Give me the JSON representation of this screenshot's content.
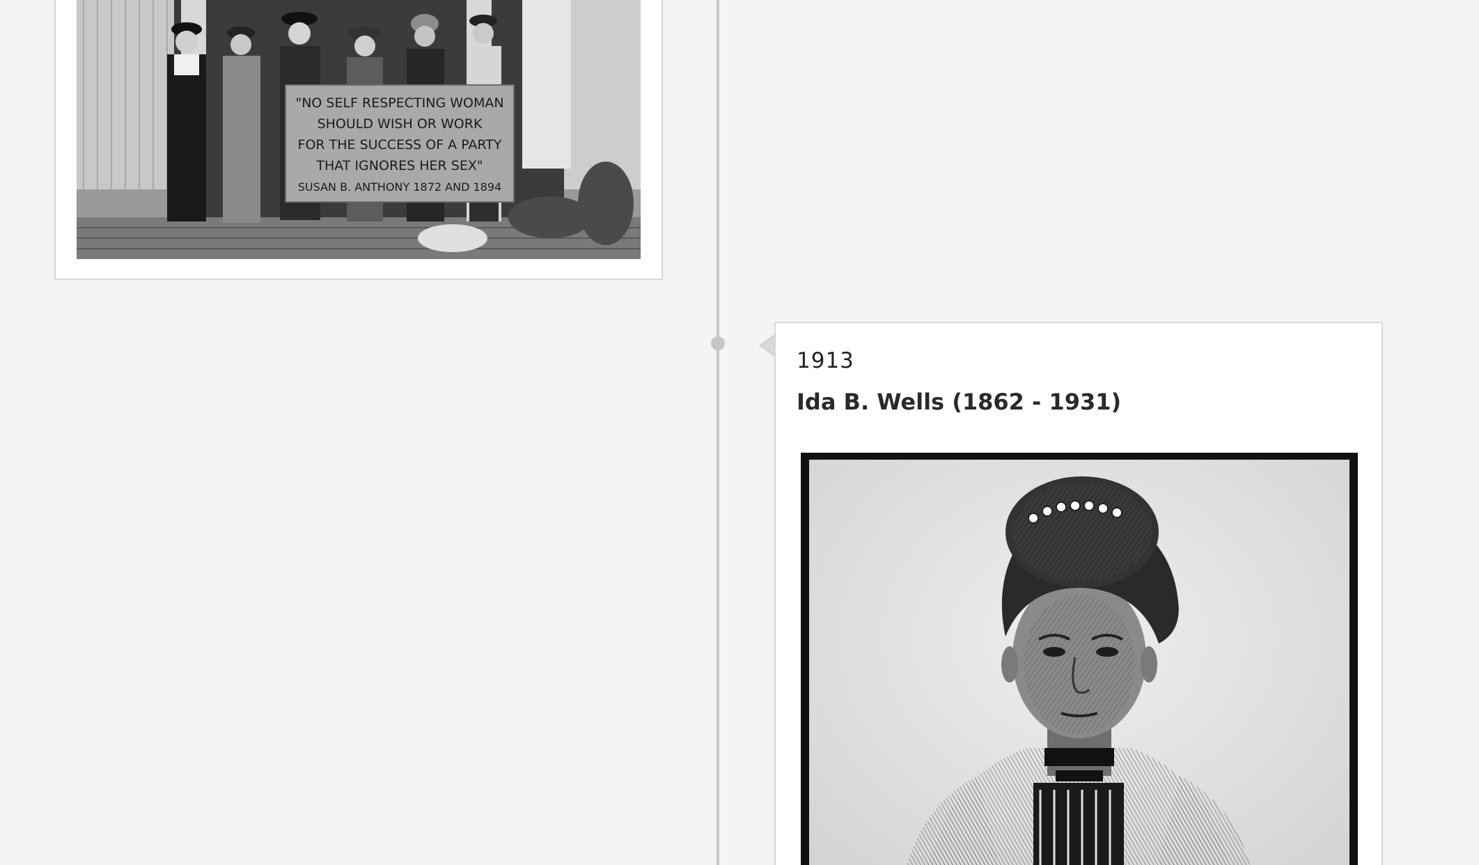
{
  "timeline": {
    "events": [
      {
        "image": {
          "alt": "Suffragists holding a banner",
          "banner_lines": [
            "\"NO SELF RESPECTING WOMAN",
            "SHOULD WISH OR WORK",
            "FOR THE SUCCESS OF A PARTY",
            "THAT IGNORES HER SEX\"",
            "SUSAN B. ANTHONY 1872 AND 1894"
          ]
        }
      },
      {
        "year": "1913",
        "title": "Ida B. Wells (1862 - 1931)",
        "image": {
          "alt": "Engraved portrait of Ida B. Wells"
        }
      }
    ]
  },
  "colors": {
    "background": "#f4f4f4",
    "card": "#ffffff",
    "card_border": "#d6d6d6",
    "timeline_line": "#c8c8c8"
  }
}
